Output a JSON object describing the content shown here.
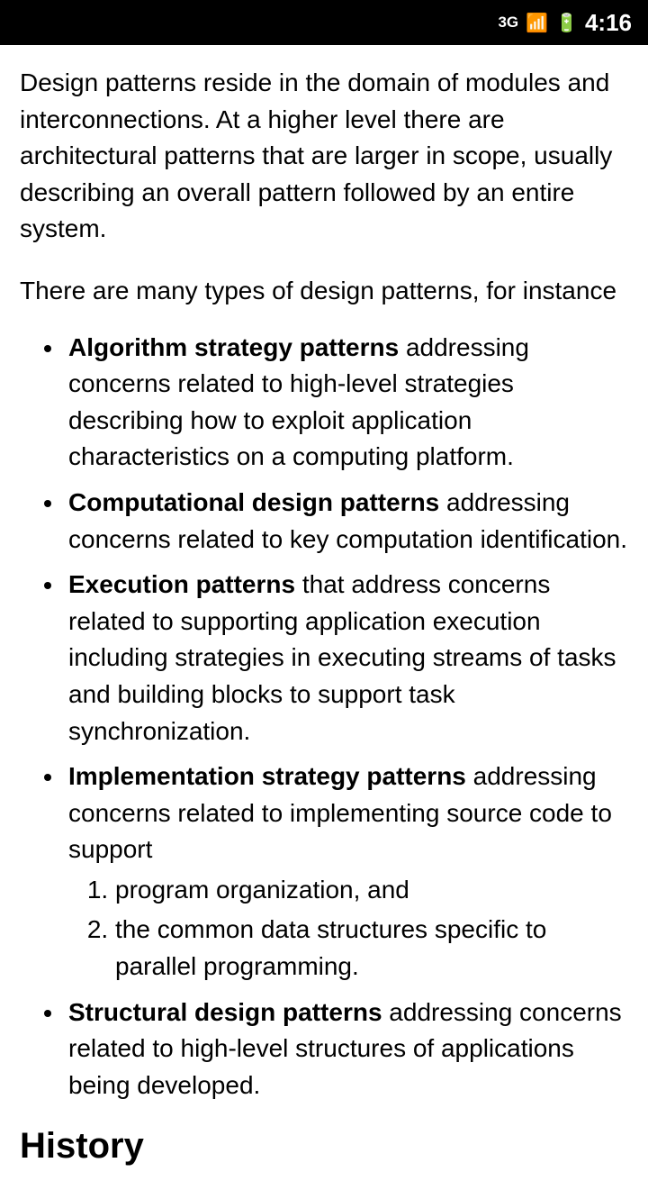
{
  "statusBar": {
    "time": "4:16",
    "signalIcon": "signal-bars",
    "batteryIcon": "battery"
  },
  "content": {
    "paragraph1": "Design patterns reside in the domain of modules and interconnections. At a higher level there are architectural patterns that are larger in scope, usually describing an overall pattern followed by an entire system.",
    "paragraph2": "There are many types of design patterns, for instance",
    "listItems": [
      {
        "bold": "Algorithm strategy patterns",
        "rest": " addressing concerns related to high-level strategies describing how to exploit application characteristics on a computing platform."
      },
      {
        "bold": "Computational design patterns",
        "rest": " addressing concerns related to key computation identification."
      },
      {
        "bold": "Execution patterns",
        "rest": " that address concerns related to supporting application execution including strategies in executing streams of tasks and building blocks to support task synchronization."
      },
      {
        "bold": "Implementation strategy patterns",
        "rest": " addressing concerns related to implementing source code to support",
        "subList": [
          "program organization, and",
          "the common data structures specific to parallel programming."
        ]
      },
      {
        "bold": "Structural design patterns",
        "rest": " addressing concerns related to high-level structures of applications being developed."
      }
    ],
    "historyHeading": "History"
  }
}
